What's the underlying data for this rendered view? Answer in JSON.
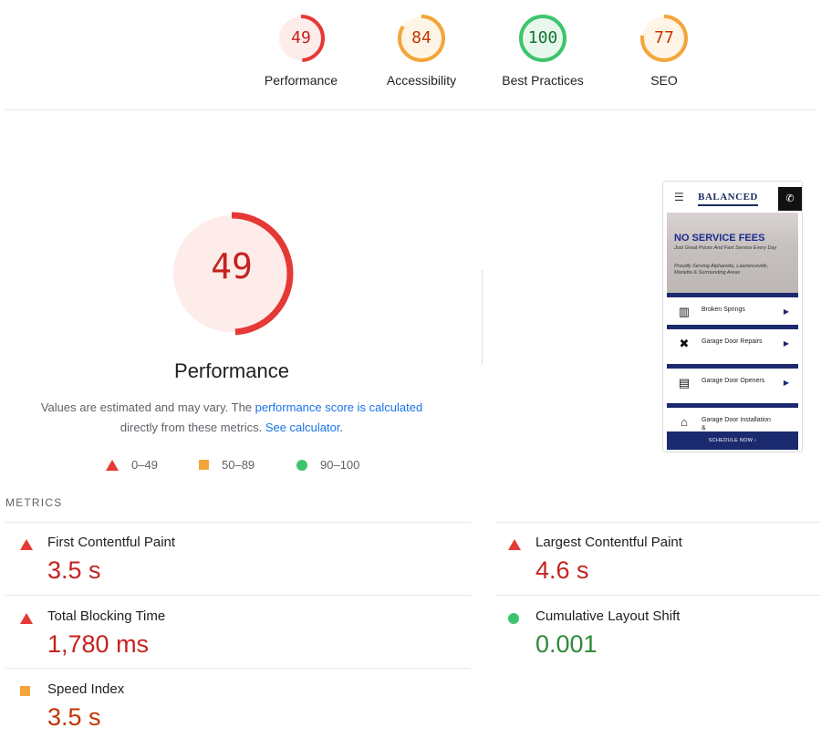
{
  "colors": {
    "fail": "#e53935",
    "average": "#f4a53a",
    "pass": "#3ec46d",
    "link": "#1a73e8"
  },
  "gauges": [
    {
      "score": "49",
      "label": "Performance",
      "value": 0.49,
      "stroke": "#e53935",
      "fill": "#fdecea",
      "text": "#c5221f"
    },
    {
      "score": "84",
      "label": "Accessibility",
      "value": 0.84,
      "stroke": "#f4a53a",
      "fill": "#fff5e6",
      "text": "#c33300"
    },
    {
      "score": "100",
      "label": "Best Practices",
      "value": 1.0,
      "stroke": "#3ec46d",
      "fill": "#e8f7ec",
      "text": "#137333"
    },
    {
      "score": "77",
      "label": "SEO",
      "value": 0.77,
      "stroke": "#f4a53a",
      "fill": "#fff5e6",
      "text": "#c33300"
    }
  ],
  "performance": {
    "score": "49",
    "value": 0.49,
    "title": "Performance",
    "desc_prefix": "Values are estimated and may vary. The ",
    "desc_link1": "performance score is calculated",
    "desc_mid": "directly from these metrics. ",
    "desc_link2": "See calculator",
    "desc_suffix": "."
  },
  "legend": [
    {
      "range": "0–49",
      "icon": "triangle-icon"
    },
    {
      "range": "50–89",
      "icon": "square-icon"
    },
    {
      "range": "90–100",
      "icon": "circle-icon"
    }
  ],
  "phone": {
    "menu_icon": "☰",
    "logo": "BALANCED",
    "hero_title": "NO SERVICE FEES",
    "hero_sub": "Just Great Prices And Fast Service Every Day",
    "hero_sub2": "Proudly Serving Alpharetta, Lawrenceville, Marietta & Surrounding Areas",
    "items": [
      {
        "label": "Broken Springs",
        "icon": "spring-icon"
      },
      {
        "label": "Garage Door Repairs",
        "icon": "tools-icon"
      },
      {
        "label": "Garage Door Openers",
        "icon": "opener-icon"
      },
      {
        "label": "Garage Door Installation &",
        "icon": "garage-icon"
      }
    ],
    "cta": "SCHEDULE NOW ›"
  },
  "metrics": {
    "header": "METRICS",
    "items": [
      {
        "label": "First Contentful Paint",
        "value": "3.5 s",
        "status": "fail"
      },
      {
        "label": "Largest Contentful Paint",
        "value": "4.6 s",
        "status": "fail"
      },
      {
        "label": "Total Blocking Time",
        "value": "1,780 ms",
        "status": "fail"
      },
      {
        "label": "Cumulative Layout Shift",
        "value": "0.001",
        "status": "pass"
      },
      {
        "label": "Speed Index",
        "value": "3.5 s",
        "status": "average"
      }
    ]
  }
}
